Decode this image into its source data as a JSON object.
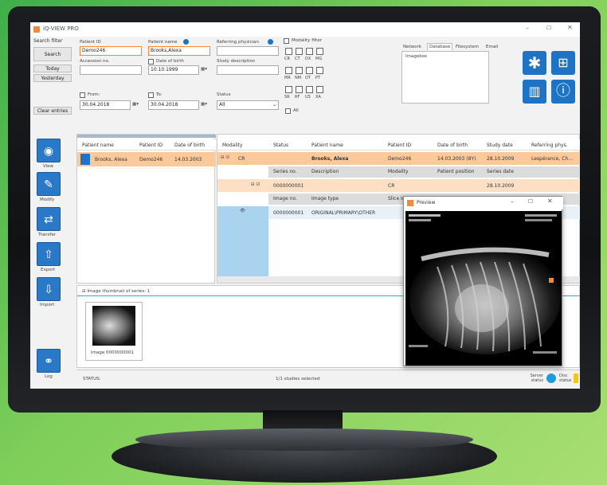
{
  "app": {
    "title": "iQ-VIEW PRO"
  },
  "search": {
    "section_title": "Search filter",
    "search_btn": "Search",
    "today_btn": "Today",
    "yesterday_btn": "Yesterday",
    "clear_btn": "Clear entries",
    "patient_id_label": "Patient ID",
    "patient_id_value": "Demo246",
    "patient_name_label": "Patient name",
    "patient_name_value": "Brooks,Alexa",
    "referring_label": "Referring physician",
    "accession_label": "Accession no.",
    "dob_label": "Date of birth",
    "dob_value": "10.10.1999",
    "study_desc_label": "Study description",
    "from_label": "From:",
    "from_value": "30.04.2018",
    "to_label": "To:",
    "to_value": "30.04.2018",
    "status_label": "Status",
    "status_value": "All",
    "modality_filter_label": "Modality filter",
    "modality_rows": [
      [
        "CR",
        "CT",
        "DX",
        "MG"
      ],
      [
        "MR",
        "NM",
        "OT",
        "PT"
      ],
      [
        "SR",
        "RF",
        "US",
        "XA"
      ]
    ],
    "modality_all": "All"
  },
  "nav_tabs": [
    "Network",
    "Database",
    "Filesystem",
    "Email"
  ],
  "tree_item": "Imagebox",
  "side": {
    "view": "View",
    "modify": "Modify",
    "transfer": "Transfer",
    "export": "Export",
    "import": "Import",
    "log": "Log"
  },
  "patient_table": {
    "headers": [
      "Patient name",
      "Patient ID",
      "Date of birth"
    ],
    "row": [
      "Brooks, Alexa",
      "Demo246",
      "14.03.2003"
    ]
  },
  "study_table": {
    "headers": [
      "Modality",
      "Status",
      "Patient name",
      "Patient ID",
      "Date of birth",
      "Study date",
      "Referring phys."
    ],
    "row": [
      "CR",
      "",
      "Brooks, Alexa",
      "Demo246",
      "14.03.2003 (8Y)",
      "28.10.2009",
      "Lespérance, Ch..."
    ],
    "series_headers": [
      "Series no.",
      "Description",
      "Modality",
      "Patient position",
      "Series date"
    ],
    "series_row": [
      "0000000001",
      "",
      "CR",
      "",
      "28.10.2009"
    ],
    "image_headers": [
      "Image no.",
      "Image type",
      "Slice lo"
    ],
    "image_row": [
      "0000000001",
      "ORIGINAL\\PRIMARY\\OTHER"
    ]
  },
  "thumbnails": {
    "title": "Image thumbnail of series: 1",
    "caption": "Image 0000000001"
  },
  "status": {
    "label": "STATUS:",
    "center": "1/1 studies selected",
    "server": "Server status",
    "disc": "Disc status"
  },
  "preview": {
    "title": "Preview"
  },
  "colors": {
    "accent": "#f08a3c",
    "blue": "#1e73c4",
    "highlight": "#fbc99a"
  }
}
